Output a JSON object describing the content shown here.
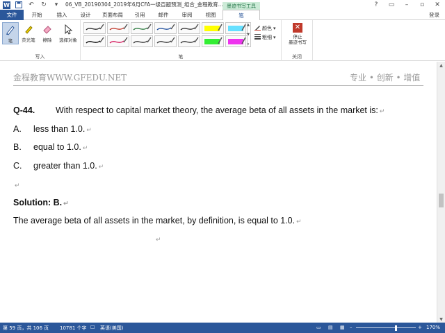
{
  "titlebar": {
    "app_icon": "W",
    "document_title": "06_VB_20190304_2019年6月CFA一级百题预测_组合_金程教育...",
    "window_buttons": [
      "?",
      "▭",
      "–",
      "▫",
      "✕"
    ]
  },
  "tabs": {
    "file": "文件",
    "items": [
      "开始",
      "插入",
      "设计",
      "页面布局",
      "引用",
      "邮件",
      "审阅",
      "视图"
    ],
    "contextual_header": "墨迹书写工具",
    "active": "笔",
    "signin": "登录"
  },
  "ribbon": {
    "write_group": {
      "label": "写入",
      "tools": [
        {
          "label": "笔",
          "icon": "pen-icon"
        },
        {
          "label": "荧光笔",
          "icon": "highlighter-icon"
        },
        {
          "label": "擦除",
          "icon": "eraser-icon"
        },
        {
          "label": "选择对象",
          "icon": "select-cursor-icon"
        }
      ]
    },
    "pens_group": {
      "label": "笔",
      "pens": [
        {
          "color": "#222222"
        },
        {
          "color": "#c0392b"
        },
        {
          "color": "#2c7a3f"
        },
        {
          "color": "#1f4e9c"
        },
        {
          "color": "#333333"
        },
        {
          "color": "#ffff00"
        },
        {
          "color": "#66e0ff"
        },
        {
          "color": "#000000"
        },
        {
          "color": "#d4145a"
        },
        {
          "color": "#333333"
        },
        {
          "color": "#333333"
        },
        {
          "color": "#333333"
        },
        {
          "color": "#33ee33"
        },
        {
          "color": "#ee33ee"
        }
      ],
      "color_label": "颜色",
      "thickness_label": "粗细"
    },
    "close_group": {
      "label": "关闭",
      "stop_label": "停止\n墨迹书写"
    }
  },
  "document": {
    "header_left": "金程教育WWW.GFEDU.NET",
    "header_right": "专业 • 创新 • 增值",
    "question_number": "Q-44.",
    "question_text": "With respect to capital market theory, the average beta of all assets in the market is:",
    "options": [
      {
        "letter": "A.",
        "text": "less than 1.0."
      },
      {
        "letter": "B.",
        "text": "equal to 1.0."
      },
      {
        "letter": "C.",
        "text": "greater than 1.0."
      }
    ],
    "solution_heading": "Solution: B.",
    "solution_text": "The average beta of all assets in the market, by definition, is equal to 1.0.",
    "paragraph_mark": "↵"
  },
  "statusbar": {
    "page": "第 59 页，共 106 页",
    "words": "10781 个字",
    "language": "英语(美国)",
    "zoom": "170%",
    "zoom_level_percent": 170
  },
  "colors": {
    "word_blue": "#2b579a",
    "context_green": "#217346"
  }
}
